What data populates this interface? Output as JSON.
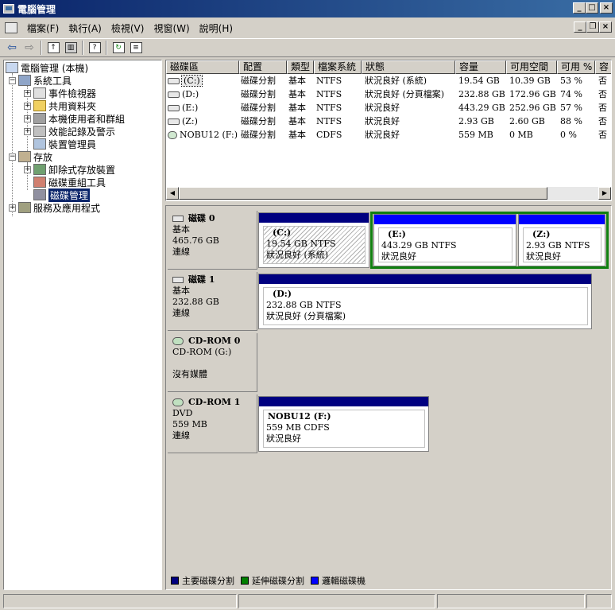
{
  "window": {
    "title": "電腦管理",
    "buttons": {
      "minimize": "_",
      "maximize": "□",
      "close": "×"
    }
  },
  "menu": {
    "items": [
      "檔案(F)",
      "執行(A)",
      "檢視(V)",
      "視窗(W)",
      "說明(H)"
    ],
    "mdi_buttons": {
      "minimize": "_",
      "restore": "❐",
      "close": "×"
    }
  },
  "toolbar": {
    "buttons": [
      "back-icon",
      "forward-icon",
      "up-folder-icon",
      "show-hide-tree-icon",
      "help-icon",
      "refresh-icon",
      "properties-icon"
    ]
  },
  "tree": {
    "items": [
      {
        "label": "電腦管理 (本機)",
        "icon": "computer-icon"
      },
      {
        "label": "系統工具",
        "icon": "tools-icon"
      },
      {
        "label": "事件檢視器",
        "icon": "event-viewer-icon"
      },
      {
        "label": "共用資料夾",
        "icon": "shared-folder-icon"
      },
      {
        "label": "本機使用者和群組",
        "icon": "users-icon"
      },
      {
        "label": "效能記錄及警示",
        "icon": "performance-icon"
      },
      {
        "label": "裝置管理員",
        "icon": "device-manager-icon"
      },
      {
        "label": "存放",
        "icon": "storage-icon"
      },
      {
        "label": "卸除式存放裝置",
        "icon": "removable-storage-icon"
      },
      {
        "label": "磁碟重組工具",
        "icon": "defrag-icon"
      },
      {
        "label": "磁碟管理",
        "icon": "disk-management-icon",
        "selected": true
      },
      {
        "label": "服務及應用程式",
        "icon": "services-icon"
      }
    ]
  },
  "volume_list": {
    "columns": [
      "磁碟區",
      "配置",
      "類型",
      "檔案系統",
      "狀態",
      "容量",
      "可用空間",
      "可用 %",
      "容"
    ],
    "rows": [
      {
        "volume": "(C:)",
        "layout": "磁碟分割",
        "type": "基本",
        "fs": "NTFS",
        "status": "狀況良好 (系統)",
        "capacity": "19.54 GB",
        "free": "10.39 GB",
        "pct": "53 %",
        "ft": "否"
      },
      {
        "volume": "(D:)",
        "layout": "磁碟分割",
        "type": "基本",
        "fs": "NTFS",
        "status": "狀況良好 (分頁檔案)",
        "capacity": "232.88 GB",
        "free": "172.96 GB",
        "pct": "74 %",
        "ft": "否"
      },
      {
        "volume": "(E:)",
        "layout": "磁碟分割",
        "type": "基本",
        "fs": "NTFS",
        "status": "狀況良好",
        "capacity": "443.29 GB",
        "free": "252.96 GB",
        "pct": "57 %",
        "ft": "否"
      },
      {
        "volume": "(Z:)",
        "layout": "磁碟分割",
        "type": "基本",
        "fs": "NTFS",
        "status": "狀況良好",
        "capacity": "2.93 GB",
        "free": "2.60 GB",
        "pct": "88 %",
        "ft": "否"
      },
      {
        "volume": "NOBU12 (F:)",
        "layout": "磁碟分割",
        "type": "基本",
        "fs": "CDFS",
        "status": "狀況良好",
        "capacity": "559 MB",
        "free": "0 MB",
        "pct": "0 %",
        "ft": "否"
      }
    ]
  },
  "disks": [
    {
      "name": "磁碟 0",
      "type": "基本",
      "size": "465.76 GB",
      "state": "連線",
      "volumes": [
        {
          "name": "(C:)",
          "detail": "19.54 GB NTFS",
          "status": "狀況良好 (系統)"
        },
        {
          "name": "(E:)",
          "detail": "443.29 GB NTFS",
          "status": "狀況良好"
        },
        {
          "name": "(Z:)",
          "detail": "2.93 GB NTFS",
          "status": "狀況良好"
        }
      ]
    },
    {
      "name": "磁碟 1",
      "type": "基本",
      "size": "232.88 GB",
      "state": "連線",
      "volumes": [
        {
          "name": "(D:)",
          "detail": "232.88 GB NTFS",
          "status": "狀況良好 (分頁檔案)"
        }
      ]
    },
    {
      "name": "CD-ROM 0",
      "type": "CD-ROM (G:)",
      "size": "",
      "state": "沒有媒體",
      "volumes": []
    },
    {
      "name": "CD-ROM 1",
      "type": "DVD",
      "size": "559 MB",
      "state": "連線",
      "volumes": [
        {
          "name": "NOBU12  (F:)",
          "detail": "559 MB CDFS",
          "status": "狀況良好"
        }
      ]
    }
  ],
  "legend": [
    {
      "label": "主要磁碟分割",
      "color": "#000080"
    },
    {
      "label": "延伸磁碟分割",
      "color": "#008000"
    },
    {
      "label": "邏輯磁碟機",
      "color": "#0000ff"
    }
  ],
  "colors": {
    "primary": "#000080",
    "extended": "#108010",
    "logical": "#0000ff"
  }
}
